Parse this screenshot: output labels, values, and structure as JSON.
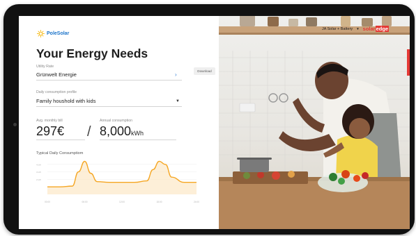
{
  "app": {
    "logo_text": "PoleSolar",
    "page_title": "Your Energy Needs"
  },
  "utility": {
    "label": "Utility Rate",
    "value": "Grünwelt Energie",
    "download_label": "Download"
  },
  "profile": {
    "label": "Daily consumption profile",
    "value": "Family houshold with kids"
  },
  "bill": {
    "label": "Avg. monthly bill",
    "value": "297€"
  },
  "consumption": {
    "label": "Annual consumption",
    "value": "8,000",
    "unit": "kWh"
  },
  "chart": {
    "title": "Typical Daily Consumptiom"
  },
  "chart_data": {
    "type": "area",
    "title": "Typical Daily Consumptiom",
    "x_ticks": [
      "00:00",
      "06:00",
      "12:00",
      "18:00",
      "24:00"
    ],
    "y_ticks": [
      "4 kW",
      "3 kW",
      "2 kW"
    ],
    "x": [
      0,
      2,
      4,
      5,
      6,
      7,
      8,
      10,
      12,
      14,
      16,
      17,
      18,
      19,
      20,
      22,
      24
    ],
    "y": [
      1.0,
      1.0,
      1.1,
      3.0,
      4.4,
      2.8,
      1.7,
      1.6,
      1.6,
      1.6,
      1.8,
      3.3,
      4.4,
      4.0,
      2.3,
      1.6,
      1.6
    ],
    "ylim": [
      0,
      5
    ],
    "color": "#f5a623",
    "grid": true
  },
  "header_right": {
    "product": "JA Solar + Battery",
    "brand_prefix": "solar",
    "brand_suffix": "edge"
  },
  "colors": {
    "accent": "#1a73c9",
    "chart": "#f5a623",
    "brand": "#e53935"
  },
  "icons": {
    "logo": "sun-logo-icon",
    "chevron": "chevron-right-icon",
    "caret": "caret-down-icon"
  }
}
